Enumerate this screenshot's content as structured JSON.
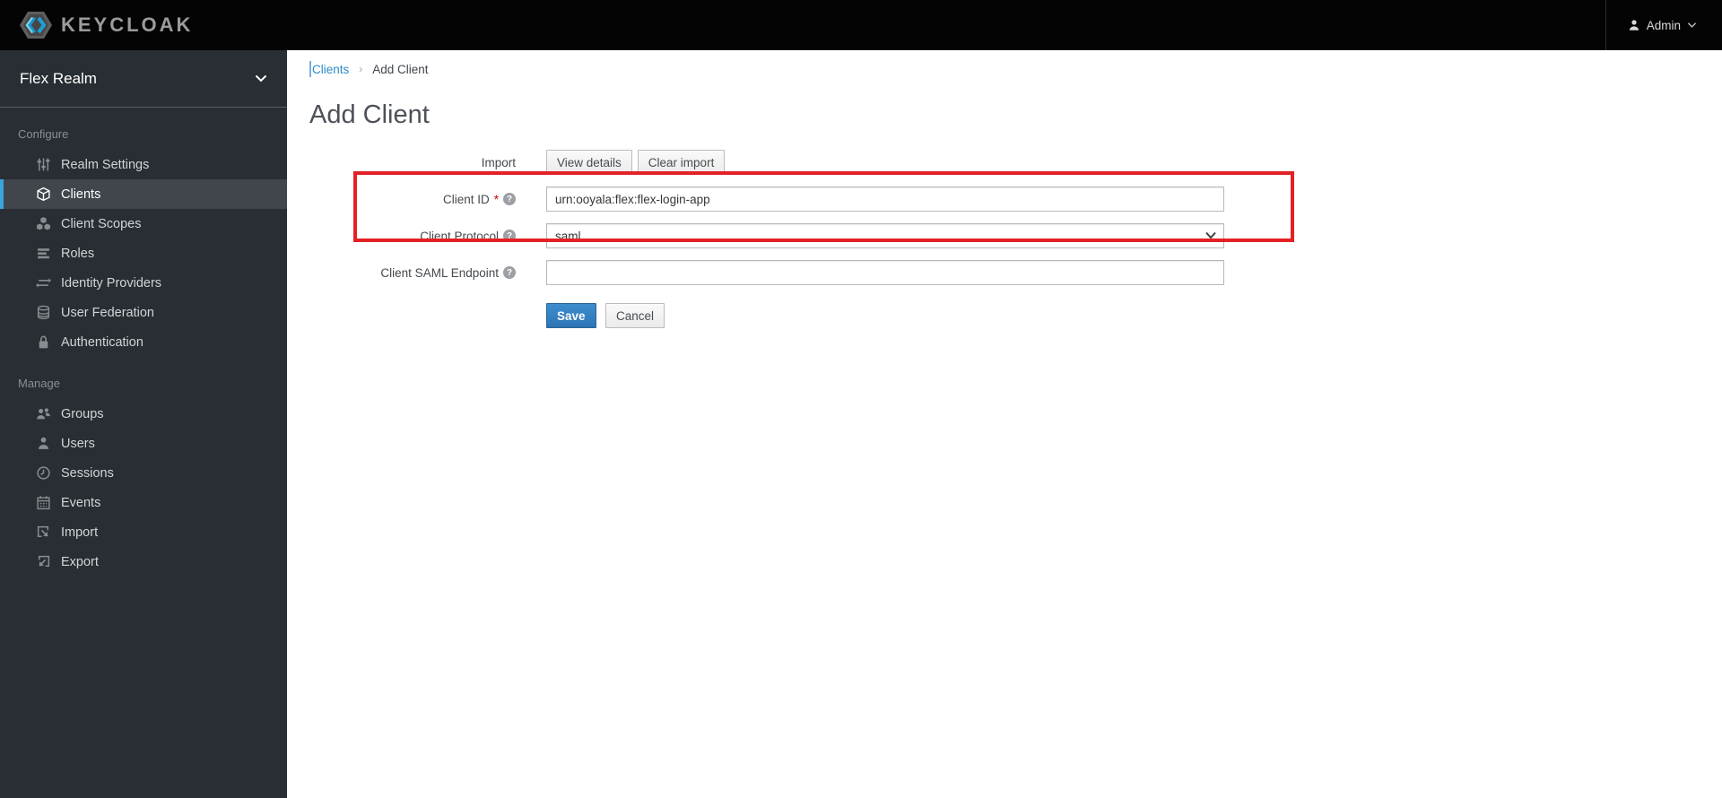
{
  "header": {
    "brand": "KEYCLOAK",
    "logo_icon": "keycloak-hexagon-logo",
    "user_menu": {
      "label": "Admin",
      "icons": [
        "user-icon",
        "chevron-down-icon"
      ]
    }
  },
  "sidebar": {
    "realm_selector": {
      "label": "Flex Realm",
      "icon": "chevron-down-icon"
    },
    "sections": [
      {
        "label": "Configure",
        "items": [
          {
            "label": "Realm Settings",
            "icon": "sliders-icon",
            "active": false
          },
          {
            "label": "Clients",
            "icon": "cube-icon",
            "active": true
          },
          {
            "label": "Client Scopes",
            "icon": "cubes-icon",
            "active": false
          },
          {
            "label": "Roles",
            "icon": "list-bars-icon",
            "active": false
          },
          {
            "label": "Identity Providers",
            "icon": "exchange-arrows-icon",
            "active": false
          },
          {
            "label": "User Federation",
            "icon": "database-icon",
            "active": false
          },
          {
            "label": "Authentication",
            "icon": "lock-icon",
            "active": false
          }
        ]
      },
      {
        "label": "Manage",
        "items": [
          {
            "label": "Groups",
            "icon": "group-icon",
            "active": false
          },
          {
            "label": "Users",
            "icon": "user-icon",
            "active": false
          },
          {
            "label": "Sessions",
            "icon": "clock-icon",
            "active": false
          },
          {
            "label": "Events",
            "icon": "calendar-icon",
            "active": false
          },
          {
            "label": "Import",
            "icon": "import-arrow-icon",
            "active": false
          },
          {
            "label": "Export",
            "icon": "export-arrow-icon",
            "active": false
          }
        ]
      }
    ]
  },
  "breadcrumb": {
    "items": [
      "Clients",
      "Add Client"
    ],
    "separator": "›"
  },
  "page": {
    "title": "Add Client"
  },
  "form": {
    "import": {
      "label": "Import",
      "buttons": [
        "View details",
        "Clear import"
      ]
    },
    "client_id": {
      "label": "Client ID",
      "required_mark": "*",
      "help_glyph": "?",
      "value": "urn:ooyala:flex:flex-login-app"
    },
    "client_protocol": {
      "label": "Client Protocol",
      "help_glyph": "?",
      "value": "saml"
    },
    "client_saml_endpoint": {
      "label": "Client SAML Endpoint",
      "help_glyph": "?",
      "value": ""
    },
    "actions": {
      "save": "Save",
      "cancel": "Cancel"
    }
  },
  "annotation": {
    "shape": "red-highlight-rectangle",
    "color": "#e32125"
  },
  "colors": {
    "header_bg": "#040404",
    "sidebar_bg": "#292e34",
    "active_item_bg": "#40464c",
    "active_item_bar": "#39a5dc",
    "link_blue": "#2e8bc7",
    "primary_button": "#2d74b5",
    "highlight_red": "#e32125"
  }
}
